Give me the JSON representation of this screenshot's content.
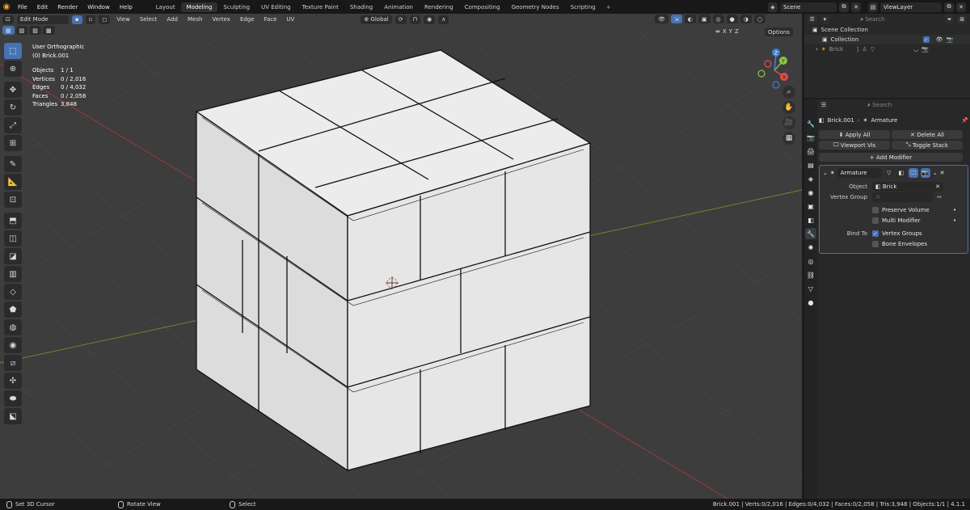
{
  "topbar": {
    "menus": [
      "File",
      "Edit",
      "Render",
      "Window",
      "Help"
    ],
    "workspaces": [
      "Layout",
      "Modeling",
      "Sculpting",
      "UV Editing",
      "Texture Paint",
      "Shading",
      "Animation",
      "Rendering",
      "Compositing",
      "Geometry Nodes",
      "Scripting"
    ],
    "active_workspace": "Modeling",
    "scene": "Scene",
    "view_layer": "ViewLayer"
  },
  "viewport_header": {
    "mode": "Edit Mode",
    "menus": [
      "View",
      "Select",
      "Add",
      "Mesh",
      "Vertex",
      "Edge",
      "Face",
      "UV"
    ],
    "transform_orientation": "Global",
    "options": "Options",
    "axes": [
      "X",
      "Y",
      "Z"
    ]
  },
  "viewport": {
    "view_name": "User Orthographic",
    "object_name": "(0) Brick.001",
    "stats": [
      {
        "label": "Objects",
        "value": "1 / 1"
      },
      {
        "label": "Vertices",
        "value": "0 / 2,016"
      },
      {
        "label": "Edges",
        "value": "0 / 4,032"
      },
      {
        "label": "Faces",
        "value": "0 / 2,058"
      },
      {
        "label": "Triangles",
        "value": "3,848"
      }
    ],
    "gizmo_axes": [
      "X",
      "Y",
      "Z"
    ]
  },
  "outliner": {
    "search_placeholder": "Search",
    "scene_collection": "Scene Collection",
    "collection": "Collection",
    "object": "Brick"
  },
  "properties": {
    "search_placeholder": "Search",
    "object": "Brick.001",
    "modifier_context": "Armature",
    "apply_all": "Apply All",
    "delete_all": "Delete All",
    "viewport_vis": "Viewport Vis",
    "toggle_stack": "Toggle Stack",
    "add_modifier": "Add Modifier",
    "modifier_name": "Armature",
    "object_label": "Object",
    "object_value": "Brick",
    "vertex_group_label": "Vertex Group",
    "preserve_volume": "Preserve Volume",
    "multi_modifier": "Multi Modifier",
    "bind_to_label": "Bind To",
    "vertex_groups": "Vertex Groups",
    "bone_envelopes": "Bone Envelopes"
  },
  "statusbar": {
    "left1": "Set 3D Cursor",
    "left2": "Rotate View",
    "left3": "Select",
    "right": "Brick.001 | Verts:0/2,016 | Edges:0/4,032 | Faces:0/2,058 | Tris:3,948 | Objects:1/1 | 4.1.1"
  },
  "colors": {
    "accent": "#4772b3",
    "x_axis": "#e54c4c",
    "y_axis": "#8bc34a",
    "z_axis": "#3f83d8"
  }
}
